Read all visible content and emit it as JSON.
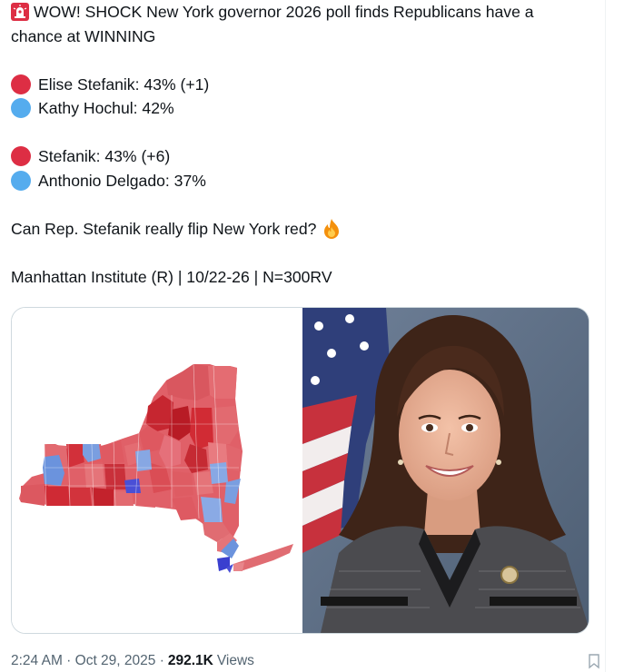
{
  "tweet": {
    "headline_line1": "WOW! SHOCK New York governor 2026 poll finds Republicans have a",
    "headline_line2": "chance at WINNING",
    "siren_icon": "police-car-light-icon",
    "matchup1": [
      {
        "text": "Elise Stefanik: 43% (+1)",
        "party_color": "#dd2e44"
      },
      {
        "text": "Kathy Hochul: 42%",
        "party_color": "#55acee"
      }
    ],
    "matchup2": [
      {
        "text": "Stefanik: 43% (+6)",
        "party_color": "#dd2e44"
      },
      {
        "text": "Anthonio Delgado: 37%",
        "party_color": "#55acee"
      }
    ],
    "question": "Can Rep. Stefanik really flip New York red?",
    "question_icon": "fire-icon",
    "source": "Manhattan Institute (R) | 10/22-26 | N=300RV"
  },
  "media": {
    "left": "new-york-county-map",
    "right": "portrait-photo"
  },
  "meta": {
    "time": "2:24 AM · Oct 29, 2025 · ",
    "views_count": "292.1K",
    "views_label": "Views"
  },
  "colors": {
    "text": "#0f1419",
    "muted": "#536471",
    "border": "#cfd9de",
    "gop_red": "#dd2e44",
    "dem_blue": "#55acee"
  }
}
